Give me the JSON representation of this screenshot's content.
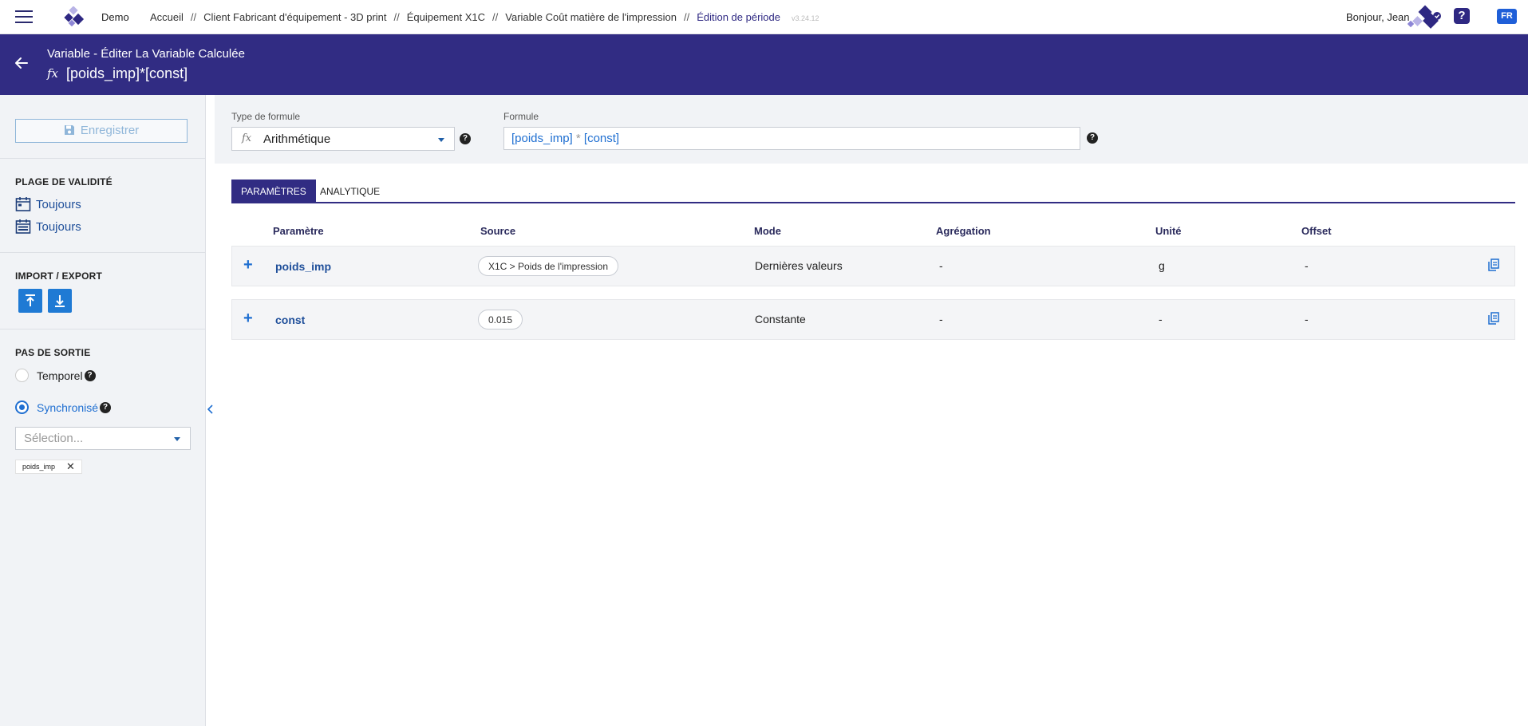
{
  "topbar": {
    "org": "Demo",
    "breadcrumb": [
      "Accueil",
      "Client Fabricant d'équipement - 3D print",
      "Équipement X1C",
      "Variable Coût matière de l'impression",
      "Édition de période"
    ],
    "separator": "//",
    "version": "v3.24.12",
    "greeting": "Bonjour, Jean",
    "help": "?",
    "lang": "FR"
  },
  "header": {
    "subtitle": "Variable - Éditer La Variable Calculée",
    "fx_icon": "fx",
    "title": "[poids_imp]*[const]"
  },
  "sidebar": {
    "save_label": "Enregistrer",
    "validity_title": "PLAGE DE VALIDITÉ",
    "validity_start": "Toujours",
    "validity_end": "Toujours",
    "import_export_title": "IMPORT / EXPORT",
    "output_step_title": "PAS DE SORTIE",
    "temporal_label": "Temporel",
    "sync_label": "Synchronisé",
    "select_placeholder": "Sélection...",
    "chip_label": "poids_imp",
    "chip_close": "✕"
  },
  "formula": {
    "type_label": "Type de formule",
    "type_icon": "fx",
    "type_value": "Arithmétique",
    "formula_label": "Formule",
    "formula_left": "[poids_imp]",
    "formula_op": " * ",
    "formula_right": "[const]",
    "help": "?"
  },
  "tabs": [
    "PARAMÈTRES",
    "ANALYTIQUE"
  ],
  "table": {
    "headers": [
      "Paramètre",
      "Source",
      "Mode",
      "Agrégation",
      "Unité",
      "Offset"
    ],
    "rows": [
      {
        "plus": "+",
        "name": "poids_imp",
        "source": "X1C > Poids de l'impression",
        "mode": "Dernières valeurs",
        "aggregation": "-",
        "unit": "g",
        "offset": "-"
      },
      {
        "plus": "+",
        "name": "const",
        "source": "0.015",
        "mode": "Constante",
        "aggregation": "-",
        "unit": "-",
        "offset": "-"
      }
    ]
  },
  "colors": {
    "brand": "#312c83",
    "accent": "#1f6fd1",
    "sidebar_bg": "#f1f3f6"
  },
  "icons": [
    "menu-icon",
    "logo-icon",
    "avatar-icon",
    "help-icon",
    "back-arrow-icon",
    "save-icon",
    "calendar-icon",
    "upload-icon",
    "download-icon",
    "chevron-left-icon",
    "copy-icon"
  ]
}
